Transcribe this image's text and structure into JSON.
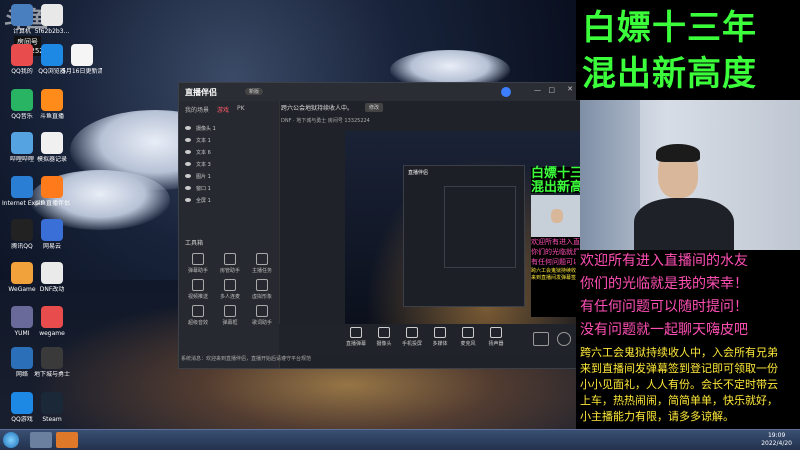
{
  "desktop": {
    "icons": [
      {
        "label": "计算机",
        "color": "#4a7fbf"
      },
      {
        "label": "5f62b2b3...",
        "color": "#e8e8e8"
      },
      {
        "label": "QQ我的",
        "color": "#e84c4c"
      },
      {
        "label": "QQ浏览器",
        "color": "#1e88e5"
      },
      {
        "label": "5月16日更新清单",
        "color": "#f5f5f5"
      },
      {
        "label": "QQ音乐",
        "color": "#28b463"
      },
      {
        "label": "斗鱼直播",
        "color": "#ff8c1a"
      },
      {
        "label": "哔哩哔哩",
        "color": "#55a3e0"
      },
      {
        "label": "模拟器记录",
        "color": "#f0f0f0"
      },
      {
        "label": "Internet Explorer",
        "color": "#2a7fd4"
      },
      {
        "label": "斗鱼直播伴侣",
        "color": "#ff7a1a"
      },
      {
        "label": "腾讯QQ",
        "color": "#222"
      },
      {
        "label": "网易云",
        "color": "#3a6fd8"
      },
      {
        "label": "WeGame",
        "color": "#f2a23a"
      },
      {
        "label": "DNF改动",
        "color": "#eaeaea"
      },
      {
        "label": "YUMI",
        "color": "#6a6a9a"
      },
      {
        "label": "wegame",
        "color": "#e84c4c"
      },
      {
        "label": "网络",
        "color": "#2a6fb8"
      },
      {
        "label": "地下城与勇士",
        "color": "#3a3a3a"
      },
      {
        "label": "QQ游戏",
        "color": "#1e88e5"
      },
      {
        "label": "Steam",
        "color": "#1b2838"
      }
    ],
    "watermark": "斗鱼",
    "room_label": "房间号",
    "room_number": "13325224"
  },
  "window": {
    "app_name": "直播伴侣",
    "version_badge": "新版",
    "tabs": [
      "我的场景",
      "游戏",
      "PK"
    ],
    "active_tab": "游戏",
    "scene_items": [
      "摄像头 1",
      "文本 1",
      "文本 6",
      "文本 3",
      "图片 1",
      "窗口 1",
      "全屏 1"
    ],
    "tools_title": "工具箱",
    "tools": [
      "弹幕助手",
      "房管助手",
      "主播任务",
      "视频推送",
      "多人连麦",
      "虚拟形象",
      "超级音效",
      "弹幕框",
      "歌词助手"
    ],
    "notice": "跨六公会地狱持续收人中。",
    "notice_button": "修改",
    "status_row": "DNF · 地下城与勇士    房间号 13325224",
    "bottom_items": [
      "直播弹幕",
      "摄像头",
      "手机投屏",
      "多媒体",
      "麦克风",
      "扬声器"
    ],
    "footer": "系统消息：欢迎来到直播伴侣，直播开始后请遵守平台规范"
  },
  "overlay": {
    "title_lines": [
      "白嫖十三年",
      "混出新高度"
    ],
    "pink_lines": [
      "欢迎所有进入直播间的水友",
      "你们的光临就是我的荣幸！",
      "有任何问题可以随时提问！",
      "没有问题就一起聊天嗨皮吧"
    ],
    "yellow_lines": [
      "跨六工会鬼狱持续收人中，入会所有兄弟",
      "来到直播间发弹幕签到登记即可领取一份",
      "小小见面礼，人人有份。会长不定时带云",
      "上车，热热闹闹，简简单单，快乐就好，",
      "小主播能力有限，请多多谅解。"
    ],
    "colors": {
      "title": "#3cff3c",
      "pink": "#ff4fb4",
      "yellow": "#ffe93a"
    }
  },
  "taskbar": {
    "time": "19:09",
    "date": "2022/4/20"
  }
}
